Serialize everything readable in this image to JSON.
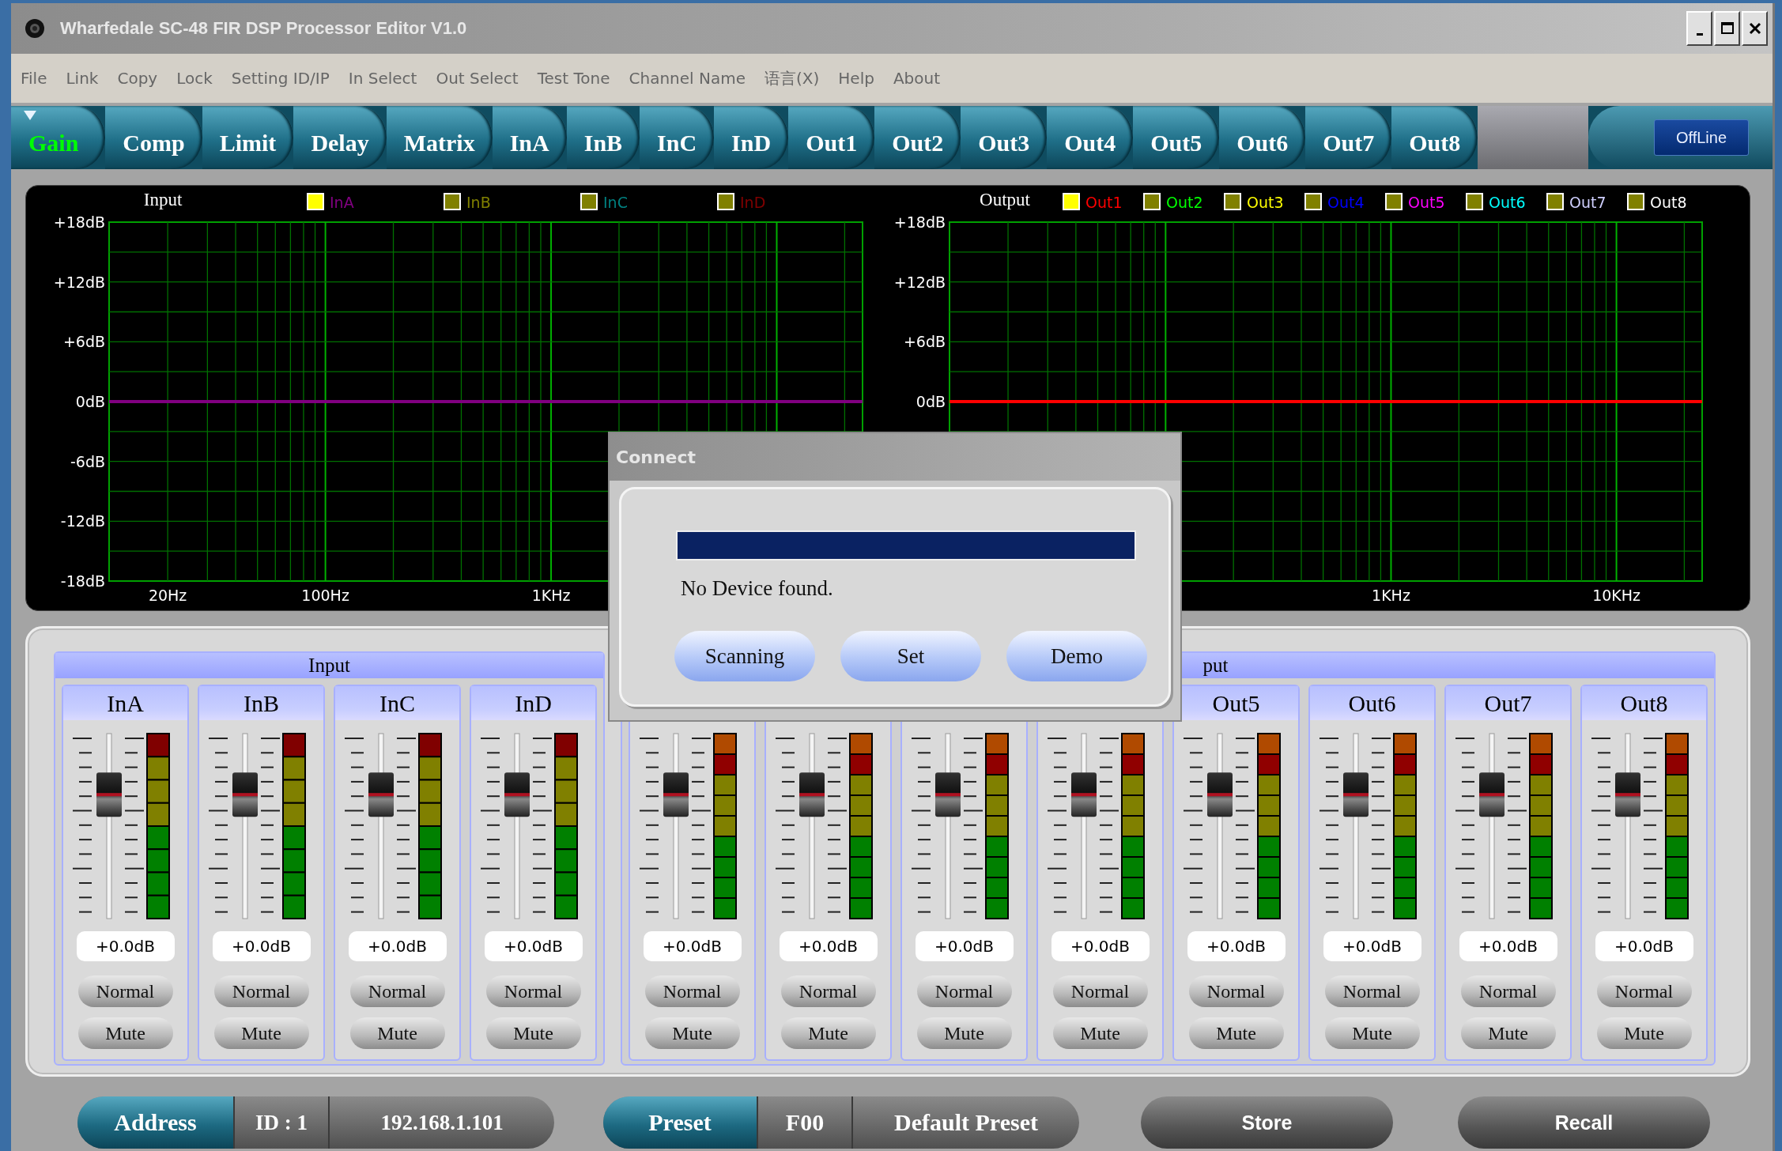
{
  "window": {
    "title": "Wharfedale SC-48 FIR DSP Processor Editor V1.0"
  },
  "menu": [
    "File",
    "Link",
    "Copy",
    "Lock",
    "Setting ID/IP",
    "In Select",
    "Out Select",
    "Test Tone",
    "Channel Name",
    "语言(X)",
    "Help",
    "About"
  ],
  "tabs": [
    {
      "label": "Gain",
      "selected": true
    },
    {
      "label": "Comp",
      "selected": false
    },
    {
      "label": "Limit",
      "selected": false
    },
    {
      "label": "Delay",
      "selected": false
    },
    {
      "label": "Matrix",
      "selected": false
    },
    {
      "label": "InA",
      "selected": false
    },
    {
      "label": "InB",
      "selected": false
    },
    {
      "label": "InC",
      "selected": false
    },
    {
      "label": "InD",
      "selected": false
    },
    {
      "label": "Out1",
      "selected": false
    },
    {
      "label": "Out2",
      "selected": false
    },
    {
      "label": "Out3",
      "selected": false
    },
    {
      "label": "Out4",
      "selected": false
    },
    {
      "label": "Out5",
      "selected": false
    },
    {
      "label": "Out6",
      "selected": false
    },
    {
      "label": "Out7",
      "selected": false
    },
    {
      "label": "Out8",
      "selected": false
    }
  ],
  "status_button": {
    "label": "OffLine"
  },
  "graphs": [
    {
      "title": "Input",
      "legend": [
        {
          "label": "InA",
          "color": "#800080",
          "checked": true
        },
        {
          "label": "InB",
          "color": "#808000",
          "checked": false
        },
        {
          "label": "InC",
          "color": "#008080",
          "checked": false
        },
        {
          "label": "InD",
          "color": "#800000",
          "checked": false
        }
      ],
      "y_labels": [
        "+18dB",
        "+12dB",
        "+6dB",
        "0dB",
        "-6dB",
        "-12dB",
        "-18dB"
      ],
      "x_labels": [
        "20Hz",
        "100Hz",
        "1KHz"
      ]
    },
    {
      "title": "Output",
      "legend": [
        {
          "label": "Out1",
          "color": "#ff0000",
          "checked": true
        },
        {
          "label": "Out2",
          "color": "#00ff00",
          "checked": false
        },
        {
          "label": "Out3",
          "color": "#ffff00",
          "checked": false
        },
        {
          "label": "Out4",
          "color": "#0000ff",
          "checked": false
        },
        {
          "label": "Out5",
          "color": "#ff00ff",
          "checked": false
        },
        {
          "label": "Out6",
          "color": "#00ffff",
          "checked": false
        },
        {
          "label": "Out7",
          "color": "#d0d0ff",
          "checked": false
        },
        {
          "label": "Out8",
          "color": "#ffffff",
          "checked": false
        }
      ],
      "y_labels": [
        "+18dB",
        "+12dB",
        "+6dB",
        "0dB"
      ],
      "x_labels": [
        "1KHz",
        "10KHz"
      ]
    }
  ],
  "channel_groups": [
    {
      "kind": "input",
      "title": "Input",
      "channels": [
        {
          "name": "InA",
          "level": 0.67,
          "gain": "+0.0dB",
          "mode": "Normal",
          "mute": "Mute"
        },
        {
          "name": "InB",
          "level": 0.67,
          "gain": "+0.0dB",
          "mode": "Normal",
          "mute": "Mute"
        },
        {
          "name": "InC",
          "level": 0.67,
          "gain": "+0.0dB",
          "mode": "Normal",
          "mute": "Mute"
        },
        {
          "name": "InD",
          "level": 0.67,
          "gain": "+0.0dB",
          "mode": "Normal",
          "mute": "Mute"
        }
      ]
    },
    {
      "kind": "output",
      "title": "put",
      "channels": [
        {
          "level": 0.67,
          "gain": "+0.0dB",
          "mode": "Normal",
          "mute": "Mute"
        },
        {
          "level": 0.67,
          "gain": "+0.0dB",
          "mode": "Normal",
          "mute": "Mute"
        },
        {
          "level": 0.67,
          "gain": "+0.0dB",
          "mode": "Normal",
          "mute": "Mute"
        },
        {
          "level": 0.67,
          "gain": "+0.0dB",
          "mode": "Normal",
          "mute": "Mute"
        },
        {
          "name": "Out5",
          "level": 0.67,
          "gain": "+0.0dB",
          "mode": "Normal",
          "mute": "Mute"
        },
        {
          "name": "Out6",
          "level": 0.67,
          "gain": "+0.0dB",
          "mode": "Normal",
          "mute": "Mute"
        },
        {
          "name": "Out7",
          "level": 0.67,
          "gain": "+0.0dB",
          "mode": "Normal",
          "mute": "Mute"
        },
        {
          "name": "Out8",
          "level": 0.67,
          "gain": "+0.0dB",
          "mode": "Normal",
          "mute": "Mute"
        }
      ]
    }
  ],
  "address_bar": {
    "label": "Address",
    "id": "ID : 1",
    "ip": "192.168.1.101"
  },
  "preset_bar": {
    "label": "Preset",
    "number": "F00",
    "name": "Default Preset"
  },
  "actions": [
    "Store",
    "Recall"
  ],
  "connect_dialog": {
    "title": "Connect",
    "level": 1,
    "message": "No Device found.",
    "buttons": [
      "Scanning",
      "Set",
      "Demo"
    ]
  }
}
